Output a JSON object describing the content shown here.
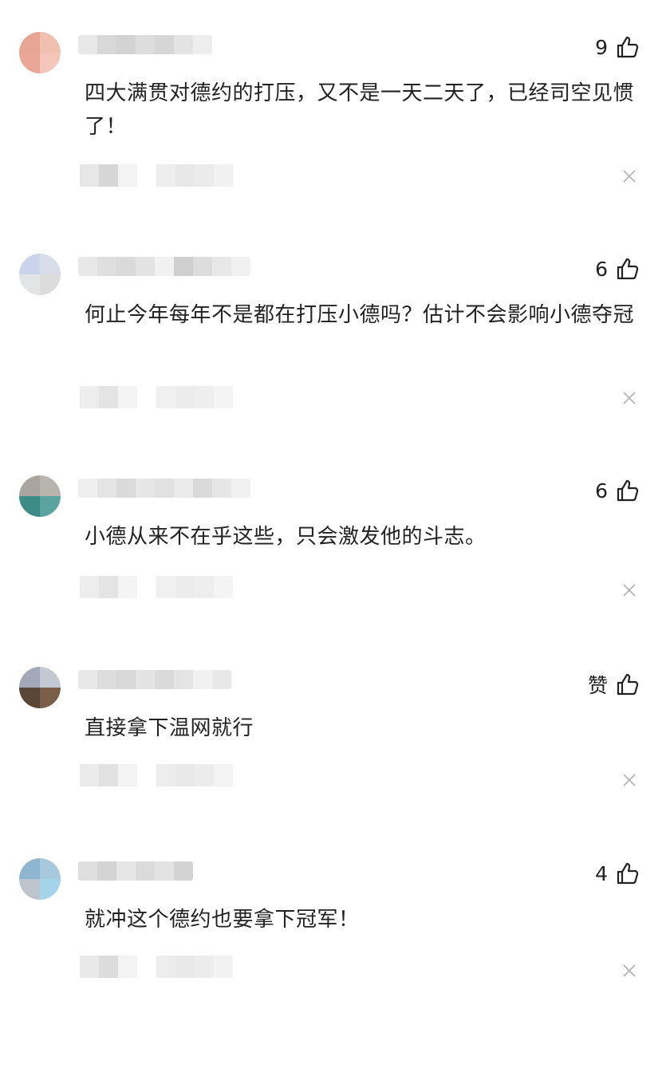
{
  "comments": [
    {
      "likes": "9",
      "text": "四大满贯对德约的打压，又不是一天二天了，已经司空见惯了！",
      "avatar_colors": [
        "#e7a594",
        "#f0bfae",
        "#eaa797",
        "#f3c6b9"
      ]
    },
    {
      "likes": "6",
      "text": "何止今年每年不是都在打压小德吗？估计不会影响小德夺冠",
      "avatar_colors": [
        "#c9d3ea",
        "#d9dde8",
        "#e2e4e6",
        "#dcdcdc"
      ]
    },
    {
      "likes": "6",
      "text": "小德从来不在乎这些，只会激发他的斗志。",
      "avatar_colors": [
        "#a9a49d",
        "#b7b3ad",
        "#3e8c87",
        "#5aa39e"
      ]
    },
    {
      "likes": "赞",
      "text": "直接拿下温网就行",
      "avatar_colors": [
        "#a3a8b8",
        "#c4c8d2",
        "#5a4637",
        "#7a5e49"
      ]
    },
    {
      "likes": "4",
      "text": "就冲这个德约也要拿下冠军！",
      "avatar_colors": [
        "#8fb6d1",
        "#a8c8de",
        "#bcc4cc",
        "#a3d4ea"
      ]
    }
  ],
  "icons": {
    "like": "thumbs-up-icon",
    "close": "close-icon"
  },
  "colors": {
    "text": "#222222",
    "close": "#b5b5b5",
    "blur": "#d0d0d0"
  }
}
